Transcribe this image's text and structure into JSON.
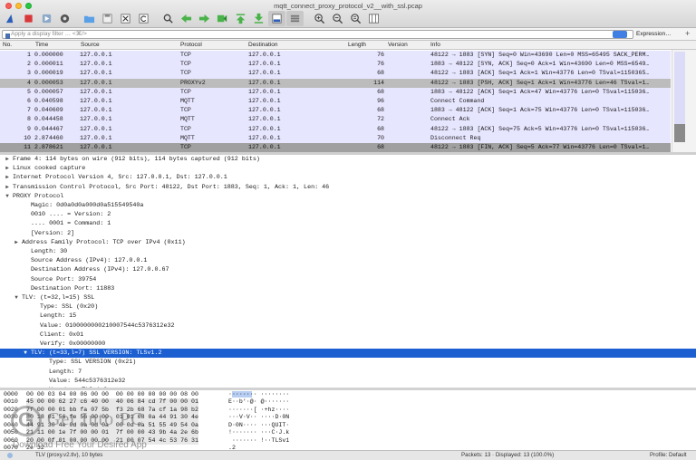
{
  "window": {
    "title": "mqtt_connect_proxy_protocol_v2__with_ssl.pcap"
  },
  "toolbar": {
    "buttons": [
      "shark-fin-icon",
      "stop-icon",
      "restart-icon",
      "options-gear-icon",
      "open-folder-icon",
      "save-file-icon",
      "close-file-icon",
      "reload-icon",
      "find-icon",
      "go-back-icon",
      "go-forward-icon",
      "go-to-packet-icon",
      "go-first-icon",
      "go-last-icon",
      "autoscroll-icon",
      "colorize-icon",
      "zoom-in-icon",
      "zoom-out-icon",
      "zoom-normal-icon",
      "resize-columns-icon"
    ]
  },
  "filter": {
    "placeholder": "Apply a display filter … <⌘/>",
    "expression_label": "Expression…",
    "plus_label": "+"
  },
  "packet_list": {
    "columns": {
      "no": "No.",
      "time": "Time",
      "source": "Source",
      "protocol": "Protocol",
      "destination": "Destination",
      "length": "Length",
      "version": "Version",
      "info": "Info"
    },
    "rows": [
      {
        "no": "1",
        "time": "0.000000",
        "src": "127.0.0.1",
        "proto": "TCP",
        "dst": "127.0.0.1",
        "len": "76",
        "info": "48122 → 1883 [SYN] Seq=0 Win=43690 Len=0 MSS=65495 SACK_PERM…",
        "style": "tcp"
      },
      {
        "no": "2",
        "time": "0.000011",
        "src": "127.0.0.1",
        "proto": "TCP",
        "dst": "127.0.0.1",
        "len": "76",
        "info": "1883 → 48122 [SYN, ACK] Seq=0 Ack=1 Win=43690 Len=0 MSS=6549…",
        "style": "tcp"
      },
      {
        "no": "3",
        "time": "0.000019",
        "src": "127.0.0.1",
        "proto": "TCP",
        "dst": "127.0.0.1",
        "len": "68",
        "info": "48122 → 1883 [ACK] Seq=1 Ack=1 Win=43776 Len=0 TSval=1150365…",
        "style": "tcp"
      },
      {
        "no": "4",
        "time": "0.000053",
        "src": "127.0.0.1",
        "proto": "PROXYv2",
        "dst": "127.0.0.1",
        "len": "114",
        "info": "48122 → 1883 [PSH, ACK] Seq=1 Ack=1 Win=43776 Len=46 TSval=1…",
        "style": "selected"
      },
      {
        "no": "5",
        "time": "0.000057",
        "src": "127.0.0.1",
        "proto": "TCP",
        "dst": "127.0.0.1",
        "len": "68",
        "info": "1883 → 48122 [ACK] Seq=1 Ack=47 Win=43776 Len=0 TSval=115036…",
        "style": "tcp"
      },
      {
        "no": "6",
        "time": "0.040598",
        "src": "127.0.0.1",
        "proto": "MQTT",
        "dst": "127.0.0.1",
        "len": "96",
        "info": "Connect Command",
        "style": "tcp"
      },
      {
        "no": "7",
        "time": "0.040609",
        "src": "127.0.0.1",
        "proto": "TCP",
        "dst": "127.0.0.1",
        "len": "68",
        "info": "1883 → 48122 [ACK] Seq=1 Ack=75 Win=43776 Len=0 TSval=115036…",
        "style": "tcp"
      },
      {
        "no": "8",
        "time": "0.044458",
        "src": "127.0.0.1",
        "proto": "MQTT",
        "dst": "127.0.0.1",
        "len": "72",
        "info": "Connect Ack",
        "style": "tcp"
      },
      {
        "no": "9",
        "time": "0.044467",
        "src": "127.0.0.1",
        "proto": "TCP",
        "dst": "127.0.0.1",
        "len": "68",
        "info": "48122 → 1883 [ACK] Seq=75 Ack=5 Win=43776 Len=0 TSval=115036…",
        "style": "tcp"
      },
      {
        "no": "10",
        "time": "2.874460",
        "src": "127.0.0.1",
        "proto": "MQTT",
        "dst": "127.0.0.1",
        "len": "70",
        "info": "Disconnect Req",
        "style": "tcp"
      },
      {
        "no": "11",
        "time": "2.878621",
        "src": "127.0.0.1",
        "proto": "TCP",
        "dst": "127.0.0.1",
        "len": "68",
        "info": "48122 → 1883 [FIN, ACK] Seq=5 Ack=77 Win=43776 Len=0 TSval=1…",
        "style": "fin"
      },
      {
        "no": "12",
        "time": "2.881357",
        "src": "127.0.0.1",
        "proto": "TCP",
        "dst": "127.0.0.1",
        "len": "68",
        "info": "1883 → 48122 [FIN, ACK] Seq=77 Ack=6 Win=43776 Len=0 TSval=1…",
        "style": "fin"
      }
    ]
  },
  "details": [
    {
      "indent": 0,
      "twisty": "▶",
      "text": "Frame 4: 114 bytes on wire (912 bits), 114 bytes captured (912 bits)"
    },
    {
      "indent": 0,
      "twisty": "▶",
      "text": "Linux cooked capture"
    },
    {
      "indent": 0,
      "twisty": "▶",
      "text": "Internet Protocol Version 4, Src: 127.0.0.1, Dst: 127.0.0.1"
    },
    {
      "indent": 0,
      "twisty": "▶",
      "text": "Transmission Control Protocol, Src Port: 48122, Dst Port: 1883, Seq: 1, Ack: 1, Len: 46"
    },
    {
      "indent": 0,
      "twisty": "▼",
      "text": "PROXY Protocol"
    },
    {
      "indent": 2,
      "twisty": "",
      "text": "Magic: 0d0a0d0a000d0a515549540a"
    },
    {
      "indent": 2,
      "twisty": "",
      "text": "0010 .... = Version: 2"
    },
    {
      "indent": 2,
      "twisty": "",
      "text": ".... 0001 = Command: 1"
    },
    {
      "indent": 2,
      "twisty": "",
      "text": "[Version: 2]"
    },
    {
      "indent": 1,
      "twisty": "▶",
      "text": "Address Family Protocol: TCP over IPv4 (0x11)"
    },
    {
      "indent": 2,
      "twisty": "",
      "text": "Length: 30"
    },
    {
      "indent": 2,
      "twisty": "",
      "text": "Source Address (IPv4): 127.0.0.1"
    },
    {
      "indent": 2,
      "twisty": "",
      "text": "Destination Address (IPv4): 127.0.0.67"
    },
    {
      "indent": 2,
      "twisty": "",
      "text": "Source Port: 39754"
    },
    {
      "indent": 2,
      "twisty": "",
      "text": "Destination Port: 11883"
    },
    {
      "indent": 1,
      "twisty": "▼",
      "text": "TLV: (t=32,l=15) SSL"
    },
    {
      "indent": 3,
      "twisty": "",
      "text": "Type: SSL (0x20)"
    },
    {
      "indent": 3,
      "twisty": "",
      "text": "Length: 15"
    },
    {
      "indent": 3,
      "twisty": "",
      "text": "Value: 0100000000210007544c5376312e32"
    },
    {
      "indent": 3,
      "twisty": "",
      "text": "Client: 0x01"
    },
    {
      "indent": 3,
      "twisty": "",
      "text": "Verify: 0x00000000"
    },
    {
      "indent": 2,
      "twisty": "▼",
      "text": "TLV: (t=33,l=7) SSL VERSION: TLSv1.2",
      "selected": true
    },
    {
      "indent": 4,
      "twisty": "",
      "text": "Type: SSL VERSION (0x21)"
    },
    {
      "indent": 4,
      "twisty": "",
      "text": "Length: 7"
    },
    {
      "indent": 4,
      "twisty": "",
      "text": "Value: 544c5376312e32"
    },
    {
      "indent": 4,
      "twisty": "",
      "text": "Version: TLSv1.2"
    }
  ],
  "hex": [
    {
      "off": "0000",
      "bytes": "00 00 03 04 00 06 00 00  00 00 00 00 00 00 08 00",
      "ascii": "········ ········"
    },
    {
      "off": "0010",
      "bytes": "45 00 00 62 27 c6 40 00  40 06 84 cd 7f 00 00 01",
      "ascii": "E··b'·@· @·······"
    },
    {
      "off": "0020",
      "bytes": "7f 00 00 01 bb fa 07 5b  f3 2b 68 7a cf 1a 98 b2",
      "ascii": "·······[ ·+hz····"
    },
    {
      "off": "0030",
      "bytes": "80 18 01 56 fe 56 00 00  01 01 08 0a 44 91 30 4e",
      "ascii": "···V·V·· ····D·0N"
    },
    {
      "off": "0040",
      "bytes": "44 91 30 4e 0d 0a 0d 0a  00 0d 0a 51 55 49 54 0a",
      "ascii": "D·0N···· ···QUIT·"
    },
    {
      "off": "0050",
      "bytes": "21 11 00 1e 7f 00 00 01  7f 00 00 43 9b 4a 2e 6b",
      "ascii": "!······· ···C·J.k"
    },
    {
      "off": "0060",
      "bytes": "20 00 0f 01 00 00 00 00  21 00 07 54 4c 53 76 31",
      "ascii": " ······· !··TLSv1"
    },
    {
      "off": "0070",
      "bytes": "2e 32",
      "ascii": ".2"
    }
  ],
  "watermark": {
    "letter": "G",
    "title": "Get Into PC",
    "subtitle": "Download Free Your Desired App"
  },
  "status": {
    "field": "TLV (proxy.v2.tlv), 10 bytes",
    "packets": "Packets: 13 · Displayed: 13 (100.0%)",
    "profile": "Profile: Default"
  },
  "colors": {
    "tcp_row": "#e7e6ff",
    "selected_row": "#bcbcbc",
    "fin_row": "#a0a0a0",
    "selection_blue": "#1b5fd1",
    "hex_highlight": "#b7cdf2"
  }
}
